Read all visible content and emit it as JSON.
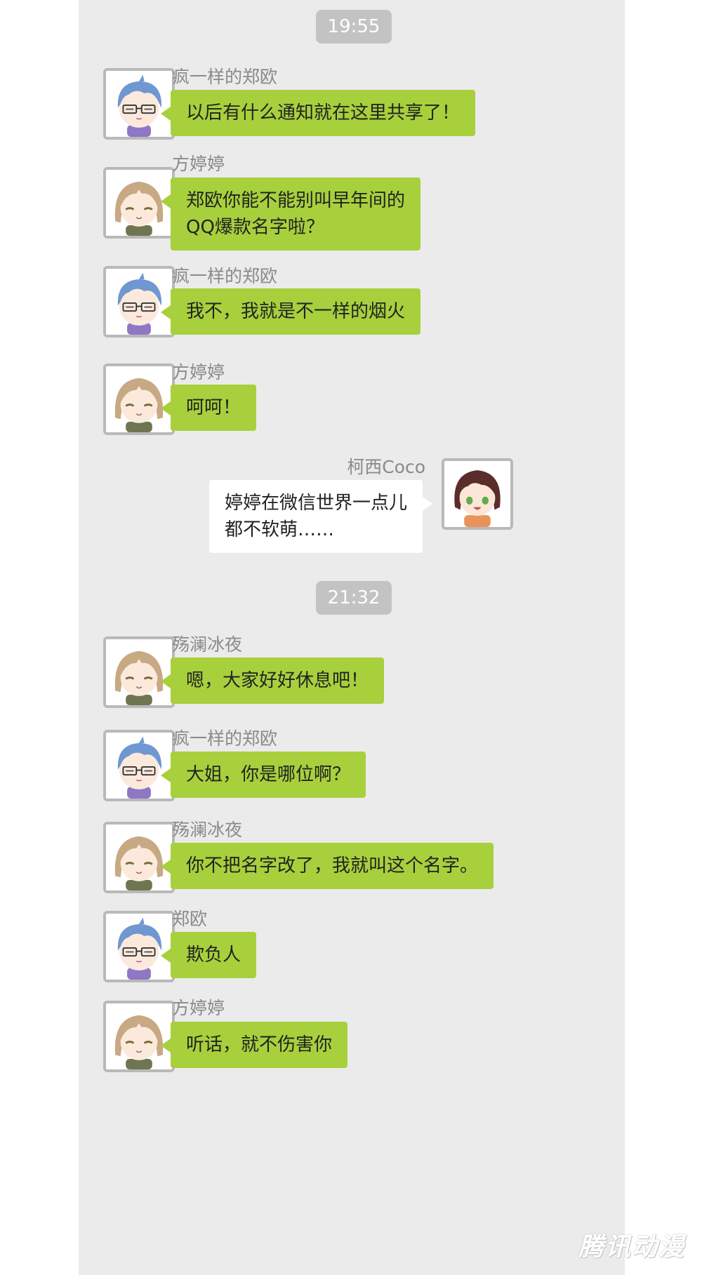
{
  "times": [
    "19:55",
    "21:32"
  ],
  "messages": [
    {
      "sender": "疯一样的郑欧",
      "lines": [
        "以后有什么通知就在这里共享了！"
      ]
    },
    {
      "sender": "方婷婷",
      "lines": [
        "郑欧你能不能别叫早年间的",
        "QQ爆款名字啦？"
      ]
    },
    {
      "sender": "疯一样的郑欧",
      "lines": [
        "我不，我就是不一样的烟火"
      ]
    },
    {
      "sender": "方婷婷",
      "lines": [
        "呵呵！"
      ]
    },
    {
      "sender": "柯西Coco",
      "lines": [
        "婷婷在微信世界一点儿",
        "都不软萌……"
      ]
    },
    {
      "sender": "殇澜冰夜",
      "lines": [
        "嗯，大家好好休息吧！"
      ]
    },
    {
      "sender": "疯一样的郑欧",
      "lines": [
        "大姐，你是哪位啊？"
      ]
    },
    {
      "sender": "殇澜冰夜",
      "lines": [
        "你不把名字改了，我就叫这个名字。"
      ]
    },
    {
      "sender": "郑欧",
      "lines": [
        "欺负人"
      ]
    },
    {
      "sender": "方婷婷",
      "lines": [
        "听话，就不伤害你"
      ]
    }
  ],
  "watermark": "腾讯动漫",
  "colors": {
    "chat_background": "#ebebeb",
    "bubble_green": "#a7d03c",
    "bubble_self": "#ffffff",
    "time_pill": "#c3c3c3",
    "sender_text": "#8a8a8a"
  },
  "avatars": {
    "zheng_ou": "blue-hair-glasses-avatar",
    "fang_tingting": "light-brown-hair-avatar",
    "coco": "dark-brown-hair-green-eyes-avatar"
  }
}
